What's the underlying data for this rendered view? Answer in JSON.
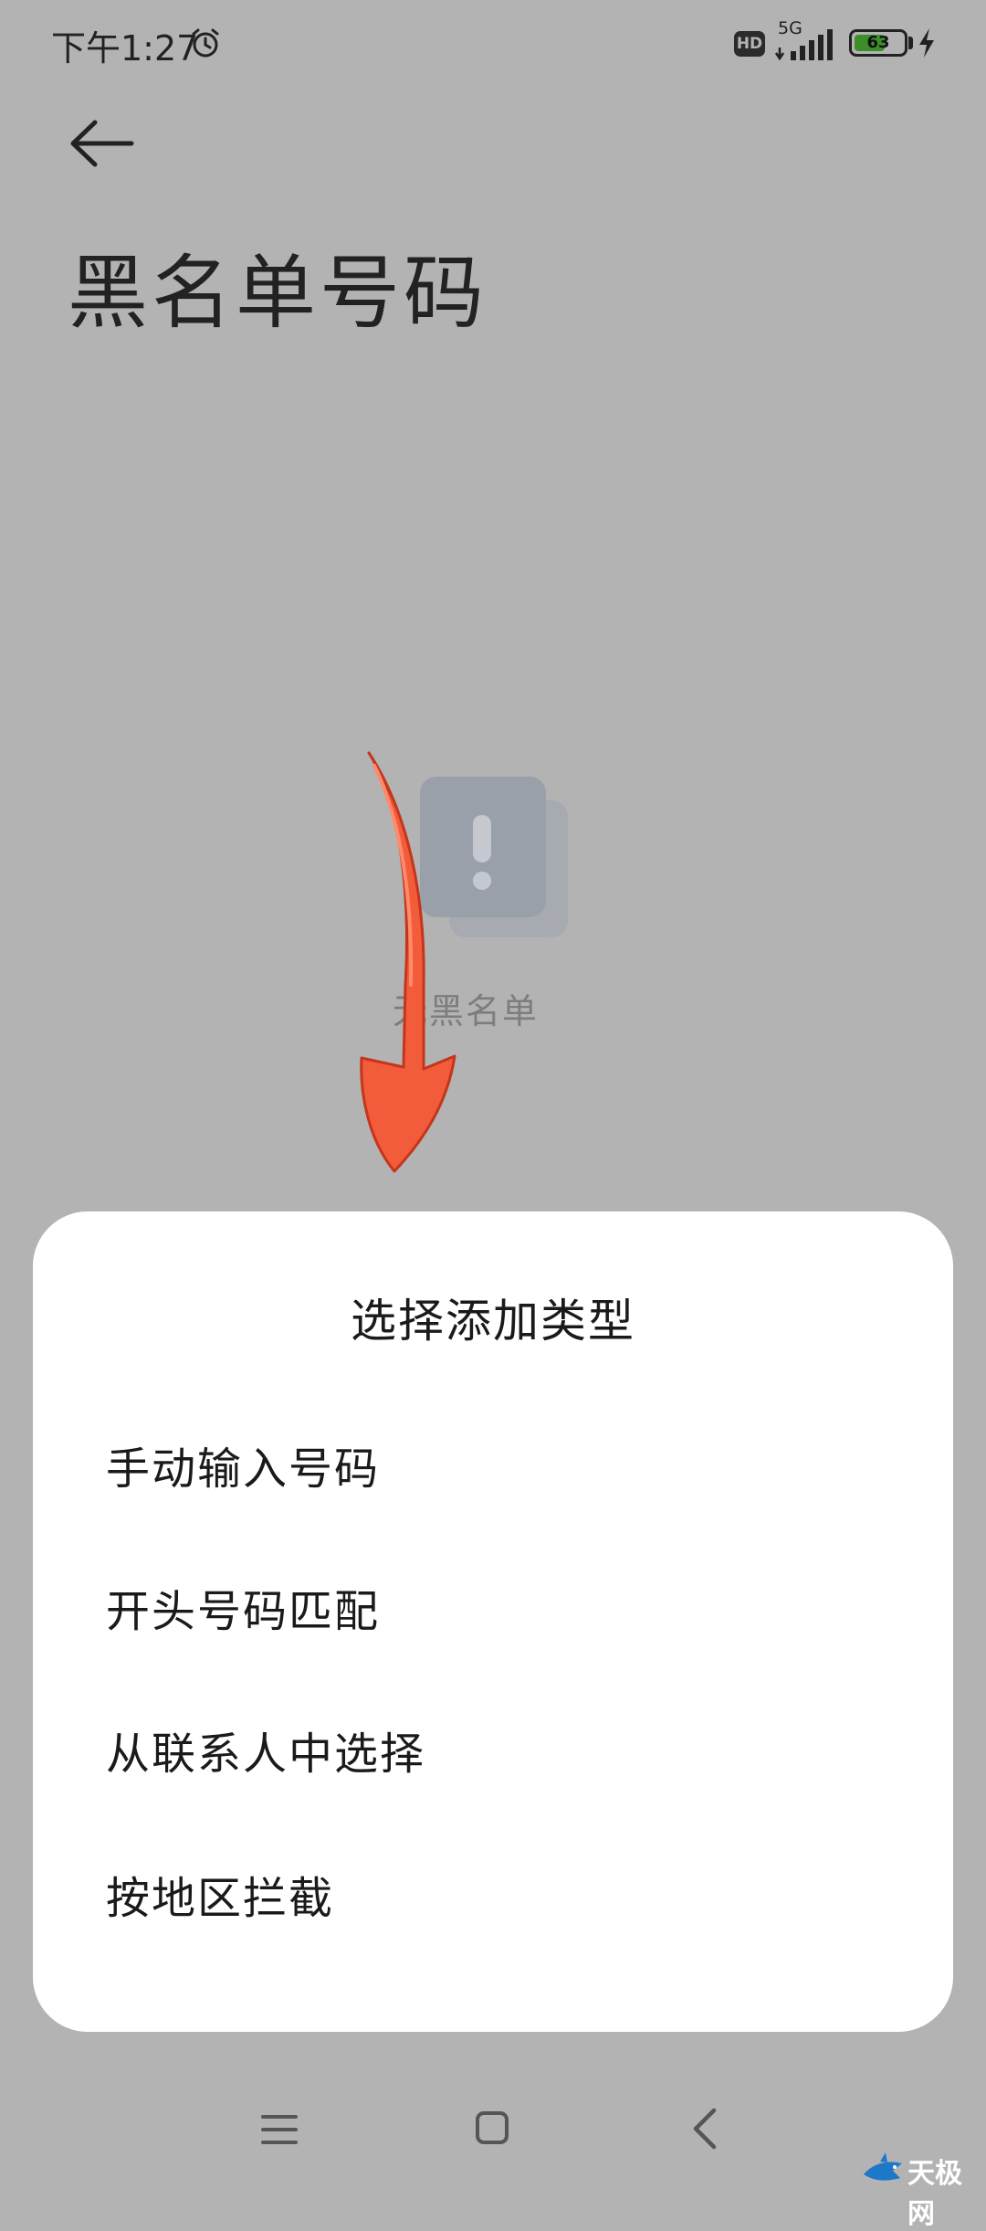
{
  "status_bar": {
    "time": "下午1:27",
    "hd_badge": "HD",
    "network": "5G",
    "battery": "63",
    "battery_level": 0.63,
    "accent_color": "#3c8e2a"
  },
  "header": {
    "back_icon": "arrow-left-icon",
    "title": "黑名单号码"
  },
  "empty_state": {
    "icon": "exclamation-card-icon",
    "text": "无黑名单"
  },
  "annotation": {
    "icon": "red-arrow-down-icon",
    "color": "#f25c3a"
  },
  "sheet": {
    "title": "选择添加类型",
    "options": [
      {
        "label": "手动输入号码"
      },
      {
        "label": "开头号码匹配"
      },
      {
        "label": "从联系人中选择"
      },
      {
        "label": "按地区拦截"
      }
    ]
  },
  "nav_bar": {
    "menu_icon": "menu-icon",
    "home_icon": "home-square-icon",
    "back_icon": "chevron-left-icon"
  },
  "watermark": {
    "text": "天极网",
    "icon": "shark-logo-icon"
  }
}
